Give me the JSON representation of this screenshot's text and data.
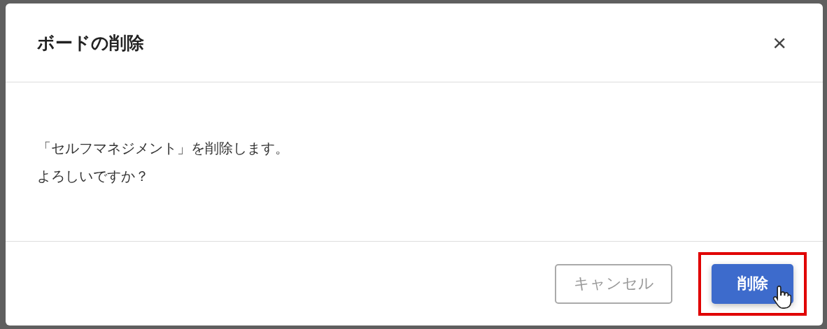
{
  "dialog": {
    "title": "ボードの削除",
    "close": "×",
    "message": [
      "「セルフマネジメント」を削除します。",
      "よろしいですか？"
    ],
    "buttons": [
      {
        "label": "キャンセル",
        "kind": "secondary",
        "highlighted": false
      },
      {
        "label": "削除",
        "kind": "primary",
        "highlighted": true
      }
    ]
  }
}
